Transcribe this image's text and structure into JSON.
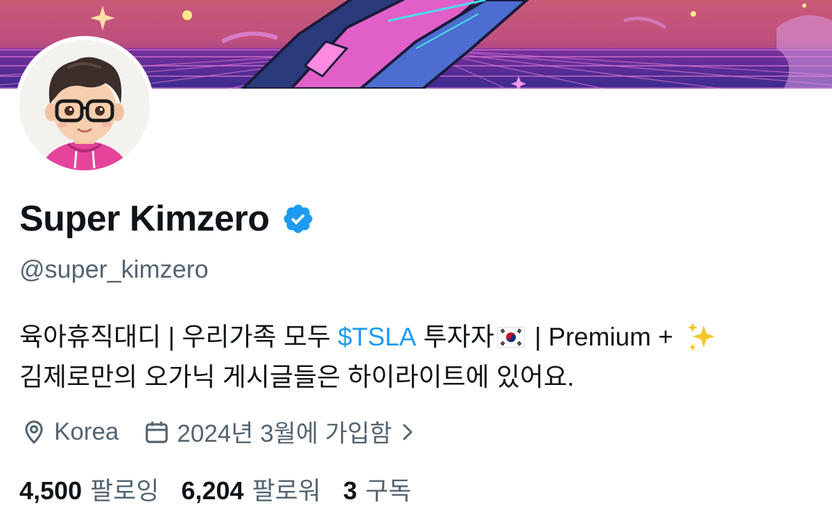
{
  "profile": {
    "display_name": "Super Kimzero",
    "handle": "@super_kimzero",
    "bio": {
      "line1_a": "육아휴직대디 | 우리가족 모두 ",
      "cashtag": "$TSLA",
      "line1_b": " 투자자",
      "line1_c": " | Premium +",
      "line2": "김제로만의 오가닉 게시글들은 하이라이트에 있어요."
    },
    "location": "Korea",
    "joined": "2024년 3월에 가입함",
    "stats": {
      "following_count": "4,500",
      "following_label": "팔로잉",
      "followers_count": "6,204",
      "followers_label": "팔로워",
      "subscriptions_count": "3",
      "subscriptions_label": "구독"
    }
  },
  "colors": {
    "accent": "#1d9bf0",
    "secondary_text": "#536471",
    "primary_text": "#0f1419"
  },
  "icons": [
    "verified-badge-icon",
    "location-pin-icon",
    "calendar-icon",
    "chevron-right-icon",
    "korea-flag-icon",
    "sparkles-icon"
  ]
}
